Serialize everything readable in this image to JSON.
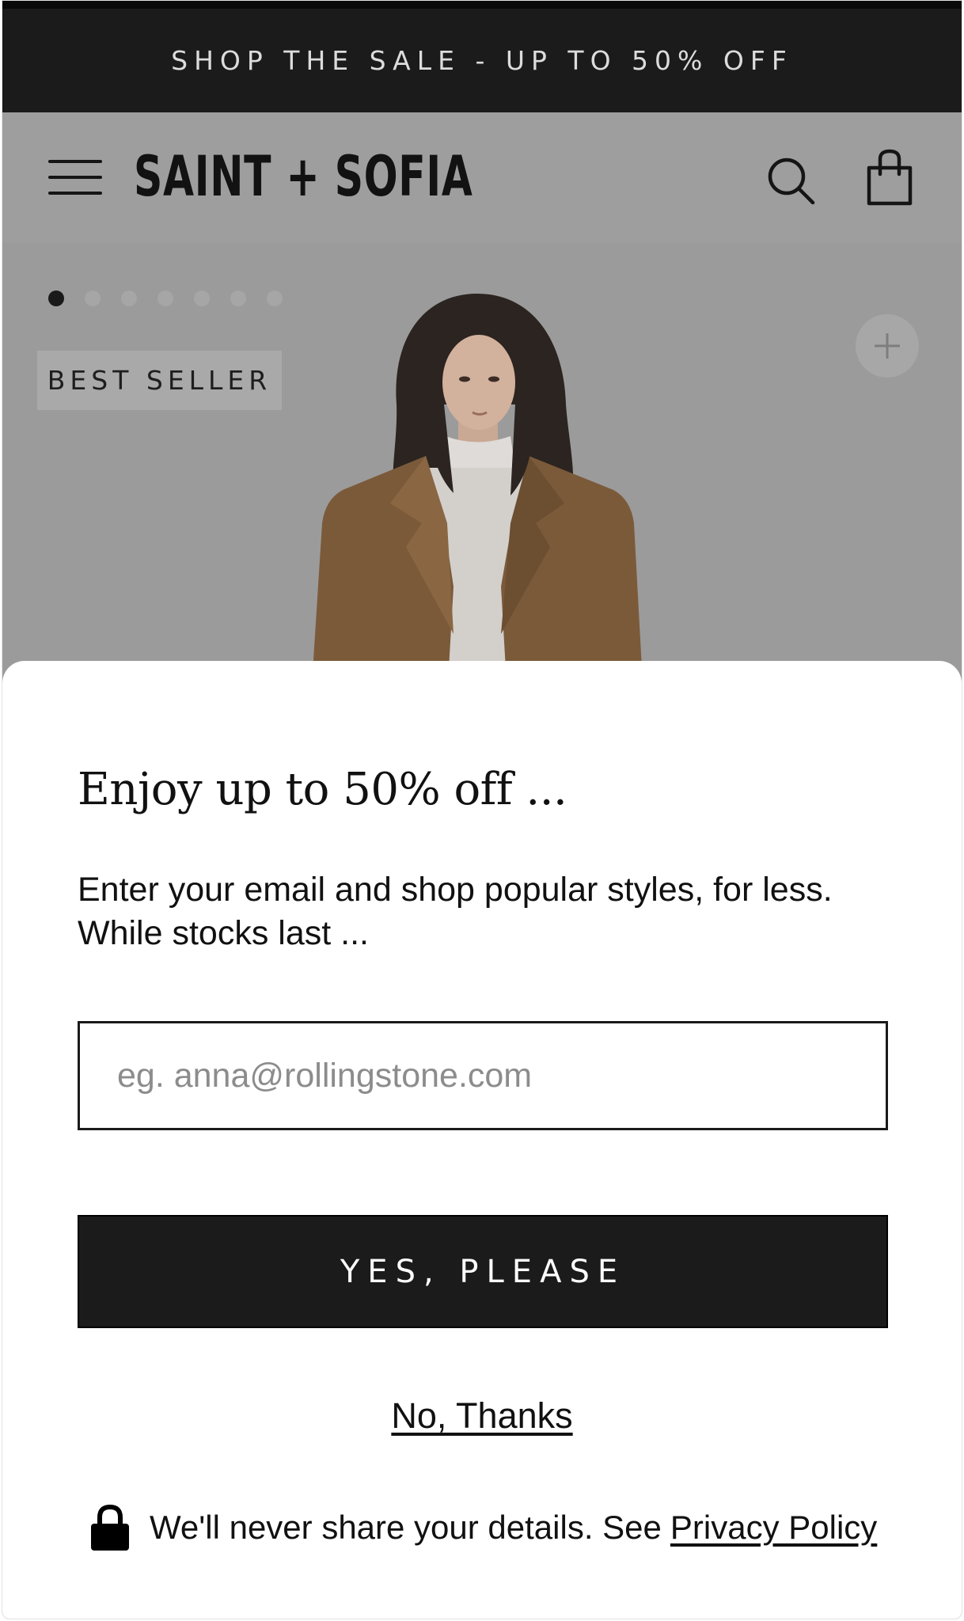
{
  "announcement": {
    "text": "SHOP THE SALE - UP TO 50% OFF"
  },
  "header": {
    "brand": "SAINT + SOFIA",
    "menu_icon": "hamburger-menu-icon",
    "search_icon": "search-icon",
    "cart_icon": "shopping-bag-icon"
  },
  "hero": {
    "badge": "BEST SELLER",
    "carousel": {
      "total_slides": 7,
      "active_slide": 1
    },
    "add_icon": "plus-icon"
  },
  "popup": {
    "title": "Enjoy up to 50% off ...",
    "text_line1": "Enter your email and shop popular styles, for less.",
    "text_line2": "While stocks last ...",
    "email": {
      "placeholder": "eg. anna@rollingstone.com",
      "value": ""
    },
    "submit_label": "YES, PLEASE",
    "decline_label": "No, Thanks",
    "privacy_text": "We'll never share your details. See",
    "privacy_link": "Privacy Policy",
    "lock_icon": "lock-icon"
  },
  "colors": {
    "dark": "#1b1b1b",
    "overlay_gray": "#9b9b9b",
    "white": "#ffffff"
  }
}
